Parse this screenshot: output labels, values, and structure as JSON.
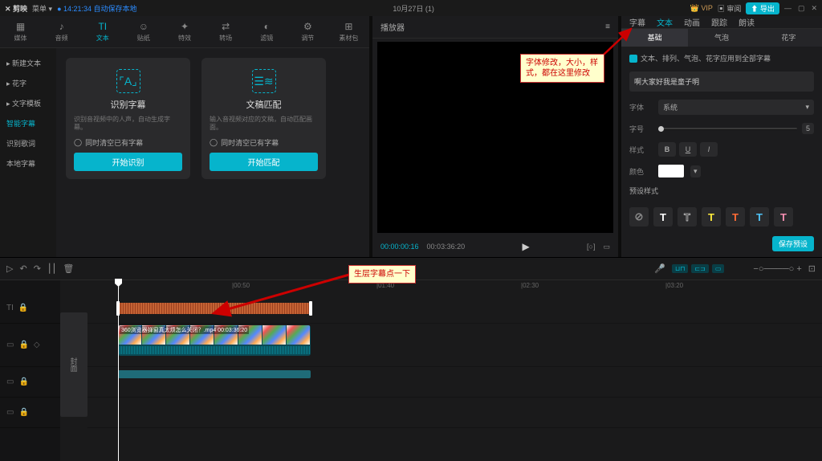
{
  "titlebar": {
    "logo": "✕ 剪映",
    "menu": "菜单 ▾",
    "saveTime": "● 14:21:34 自动保存本地",
    "project": "10月27日 (1)",
    "vip": "👑 VIP",
    "review": "▣ 审阅",
    "export": "⬆ 导出"
  },
  "mediaTabs": [
    {
      "icon": "▦",
      "label": "媒体"
    },
    {
      "icon": "♪",
      "label": "音频"
    },
    {
      "icon": "TI",
      "label": "文本",
      "active": true
    },
    {
      "icon": "☺",
      "label": "贴纸"
    },
    {
      "icon": "✦",
      "label": "特效"
    },
    {
      "icon": "⇄",
      "label": "转场"
    },
    {
      "icon": "◐",
      "label": "滤镜"
    },
    {
      "icon": "⚙",
      "label": "调节"
    },
    {
      "icon": "⊞",
      "label": "素材包"
    }
  ],
  "mediaSidebar": [
    {
      "label": "▸ 新建文本"
    },
    {
      "label": "▸ 花字"
    },
    {
      "label": "▸ 文字模板"
    },
    {
      "label": "智能字幕",
      "active": true
    },
    {
      "label": "识别歌词"
    },
    {
      "label": "本地字幕"
    }
  ],
  "cards": {
    "c1": {
      "title": "识别字幕",
      "desc": "识别音视频中的人声，自动生成字幕。",
      "chk": "同时清空已有字幕",
      "btn": "开始识别"
    },
    "c2": {
      "title": "文稿匹配",
      "desc": "输入音视频对应的文稿，自动匹配画面。",
      "chk": "同时清空已有字幕",
      "btn": "开始匹配"
    }
  },
  "player": {
    "title": "播放器",
    "tc1": "00:00:00:16",
    "tc2": "00:03:36:20"
  },
  "props": {
    "tabs": [
      "字幕",
      "文本",
      "动画",
      "跟踪",
      "朗读"
    ],
    "subtabs": [
      "基础",
      "气泡",
      "花字"
    ],
    "applyLabel": "文本、排列、气泡、花字应用到全部字幕",
    "textValue": "啊大家好我是童子明",
    "fontLabel": "字体",
    "fontValue": "系统",
    "sizeLabel": "字号",
    "sizeValue": "5",
    "styleLabel": "样式",
    "colorLabel": "颜色",
    "presetLabel": "预设样式",
    "saveBtn": "保存预设"
  },
  "ruler": [
    "|",
    "|00:50",
    "|01:40",
    "|02:30",
    "|03:20"
  ],
  "videoClipLabel": "360浏览器弹窗真太烦怎么关闭？.mp4   00:03:36:20",
  "coverLabel": "封面",
  "annotations": {
    "a1": "字体修改，大小，样式，都在这里修改",
    "a2": "生层字幕点一下"
  }
}
